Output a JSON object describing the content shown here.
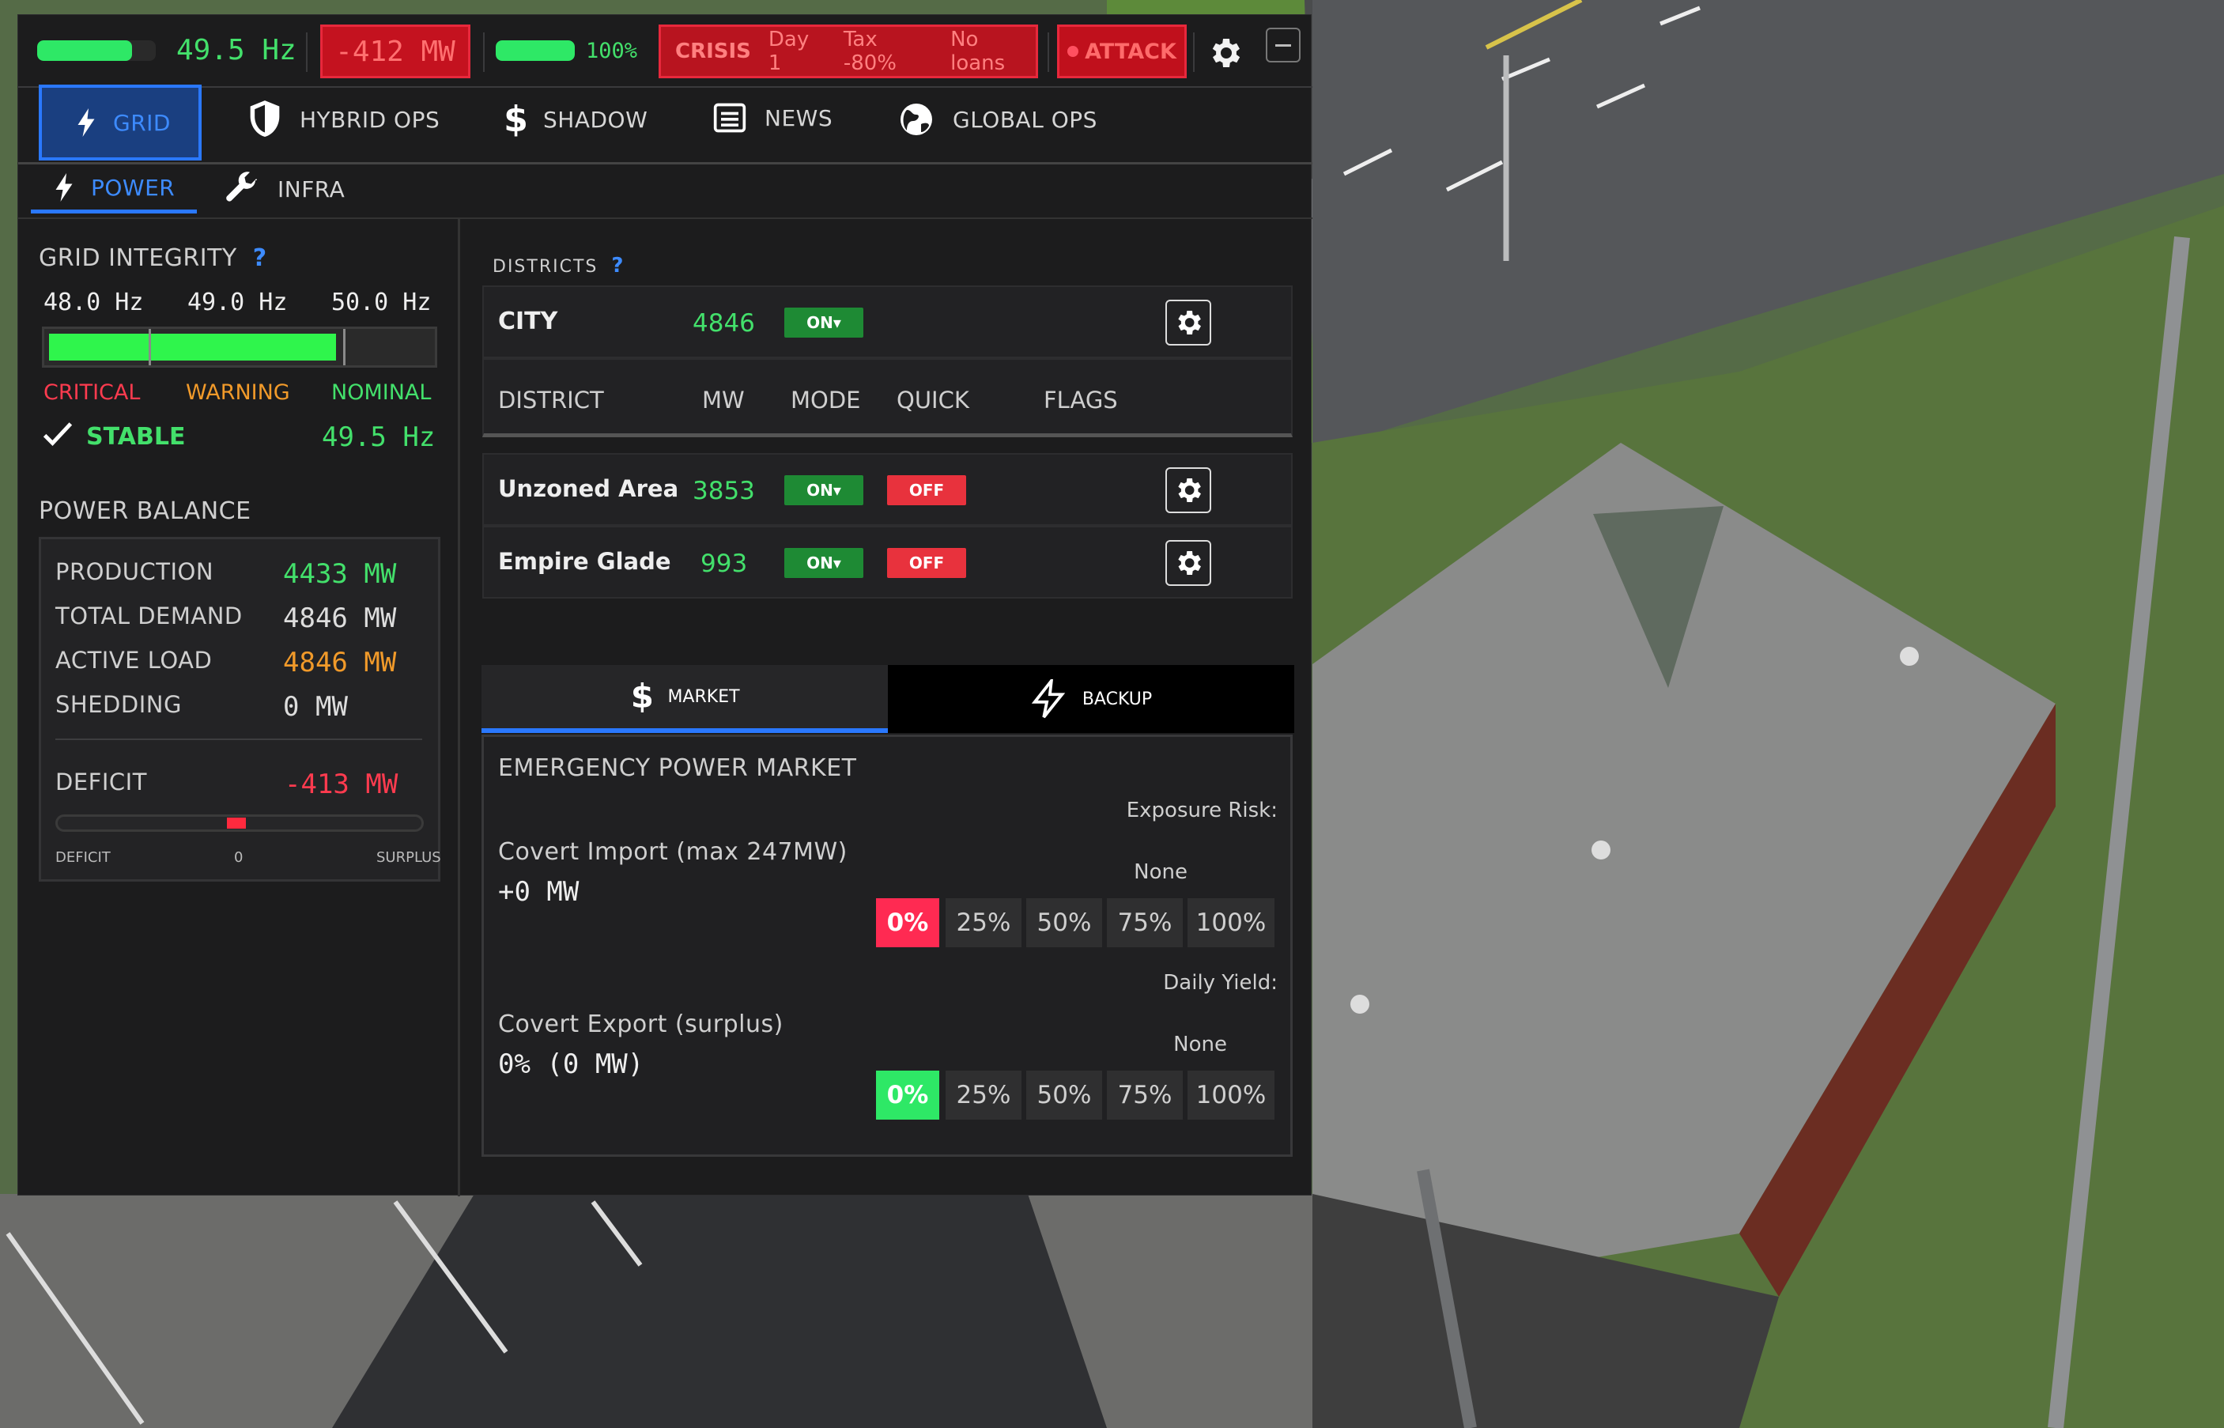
{
  "topbar": {
    "frequency_bar_fill": 0.8,
    "frequency_readout": "49.5 Hz",
    "mw_delta": "-412 MW",
    "battery_bar_fill": 1.0,
    "battery_pct": "100%",
    "crisis": {
      "label": "CRISIS",
      "day": "Day 1",
      "tax": "Tax -80%",
      "loans": "No loans"
    },
    "attack_label": "ATTACK",
    "settings_icon": "gear-icon",
    "minimize_icon": "minus-icon"
  },
  "tabs": [
    {
      "label": "GRID",
      "icon": "bolt-icon",
      "active": true
    },
    {
      "label": "HYBRID OPS",
      "icon": "shield-icon"
    },
    {
      "label": "SHADOW",
      "icon": "dollar-icon"
    },
    {
      "label": "NEWS",
      "icon": "newspaper-icon"
    },
    {
      "label": "GLOBAL OPS",
      "icon": "globe-icon"
    }
  ],
  "subtabs": [
    {
      "label": "POWER",
      "icon": "bolt-icon",
      "active": true
    },
    {
      "label": "INFRA",
      "icon": "wrench-icon"
    }
  ],
  "grid_integrity": {
    "title": "GRID INTEGRITY",
    "help": "?",
    "scale": [
      "48.0 Hz",
      "49.0 Hz",
      "50.0 Hz"
    ],
    "fill": 0.75,
    "zones": [
      "CRITICAL",
      "WARNING",
      "NOMINAL"
    ],
    "status": "STABLE",
    "value": "49.5 Hz"
  },
  "power_balance": {
    "title": "POWER BALANCE",
    "rows": [
      {
        "label": "PRODUCTION",
        "value": "4433",
        "unit": "MW"
      },
      {
        "label": "TOTAL DEMAND",
        "value": "4846",
        "unit": "MW"
      },
      {
        "label": "ACTIVE LOAD",
        "value": "4846",
        "unit": "MW"
      },
      {
        "label": "SHEDDING",
        "value": "0",
        "unit": "MW"
      }
    ],
    "deficit_label": "DEFICIT",
    "deficit_value": "-413",
    "deficit_unit": "MW",
    "slider_labels": [
      "DEFICIT",
      "0",
      "SURPLUS"
    ]
  },
  "districts": {
    "title": "DISTRICTS",
    "help": "?",
    "city": {
      "name": "CITY",
      "mw": "4846",
      "mode": "ON▾"
    },
    "headers": [
      "DISTRICT",
      "MW",
      "MODE",
      "QUICK",
      "FLAGS"
    ],
    "rows": [
      {
        "name": "Unzoned Area",
        "mw": "3853",
        "mode": "ON▾",
        "quick": "OFF"
      },
      {
        "name": "Empire Glade",
        "mw": "993",
        "mode": "ON▾",
        "quick": "OFF"
      }
    ]
  },
  "market_tabs": [
    {
      "label": "MARKET",
      "icon": "dollar-icon",
      "active": true
    },
    {
      "label": "BACKUP",
      "icon": "bolt-icon"
    }
  ],
  "market": {
    "title": "EMERGENCY POWER MARKET",
    "import": {
      "label": "Covert Import",
      "max": "(max 247MW)",
      "value": "+0 MW",
      "risk_label": "Exposure Risk:",
      "risk_value": "None",
      "options": [
        "0%",
        "25%",
        "50%",
        "75%",
        "100%"
      ],
      "selected": "0%"
    },
    "export": {
      "label": "Covert Export",
      "note": "(surplus)",
      "value": "0% (0 MW)",
      "yield_label": "Daily Yield:",
      "yield_value": "None",
      "options": [
        "0%",
        "25%",
        "50%",
        "75%",
        "100%"
      ],
      "selected": "0%"
    }
  }
}
